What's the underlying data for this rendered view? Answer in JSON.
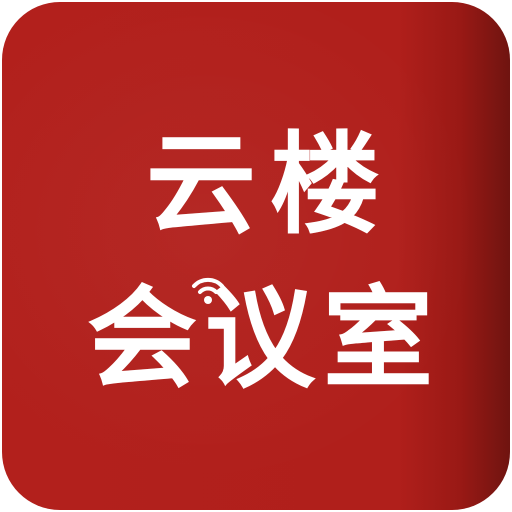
{
  "app_icon": {
    "line1": "云楼",
    "line2": "会议室",
    "background_color": "#b2201c",
    "text_color": "#ffffff",
    "decorations": [
      "cloud-icon",
      "wifi-icon"
    ]
  }
}
